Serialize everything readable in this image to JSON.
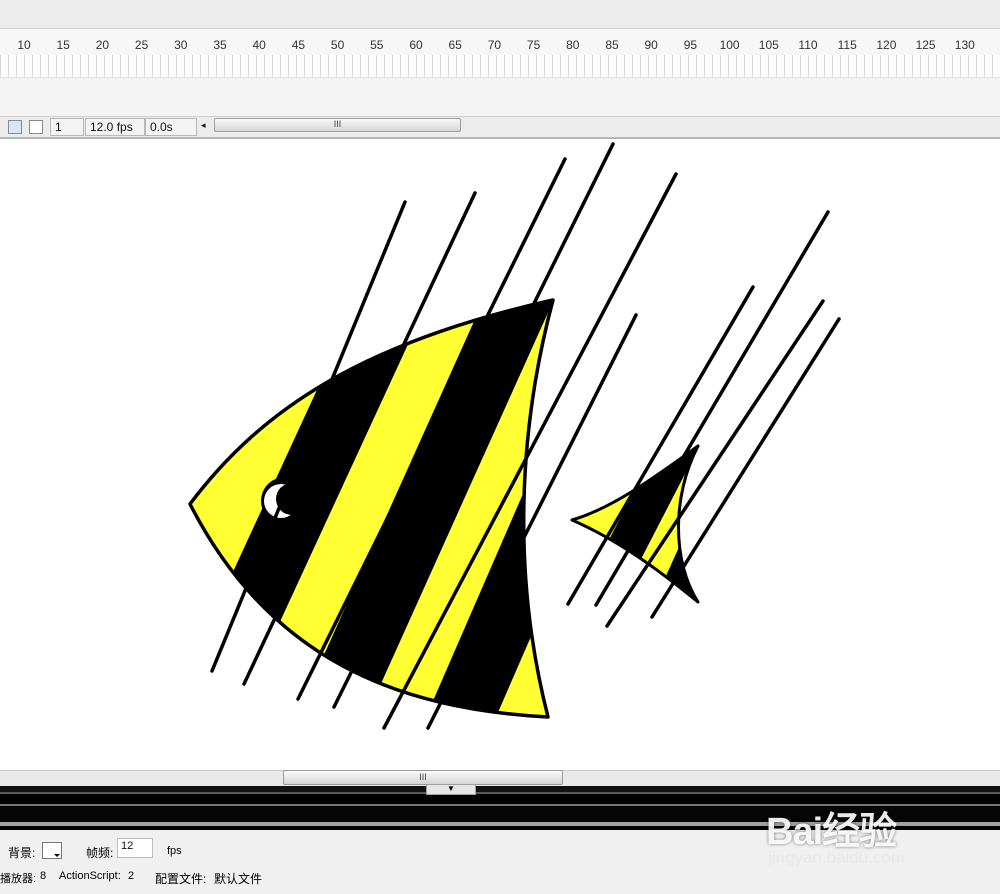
{
  "timeline": {
    "ruler_ticks": [
      "10",
      "15",
      "20",
      "25",
      "30",
      "35",
      "40",
      "45",
      "50",
      "55",
      "60",
      "65",
      "70",
      "75",
      "80",
      "85",
      "90",
      "95",
      "100",
      "105",
      "110",
      "115",
      "120",
      "125",
      "130"
    ]
  },
  "status_bar": {
    "current_frame": "1",
    "frame_rate": "12.0 fps",
    "elapsed_time": "0.0s",
    "scroll_grip": "III"
  },
  "stage": {
    "colors": {
      "fish_yellow": "#ffff33",
      "stroke": "#000000",
      "background": "#ffffff"
    }
  },
  "bottom_scroll": {
    "grip": "III"
  },
  "collapse_arrow": "▼",
  "properties": {
    "background_label": "背景:",
    "frame_rate_label": "帧频:",
    "frame_rate_value": "12",
    "fps_unit": "fps",
    "player_label": "播放器:",
    "player_value": "8",
    "actionscript_label": "ActionScript:",
    "actionscript_value": "2",
    "profile_label": "配置文件:",
    "profile_value": "默认文件"
  },
  "watermark": {
    "brand": "Bai经验",
    "url": "jingyan.baidu.com"
  }
}
